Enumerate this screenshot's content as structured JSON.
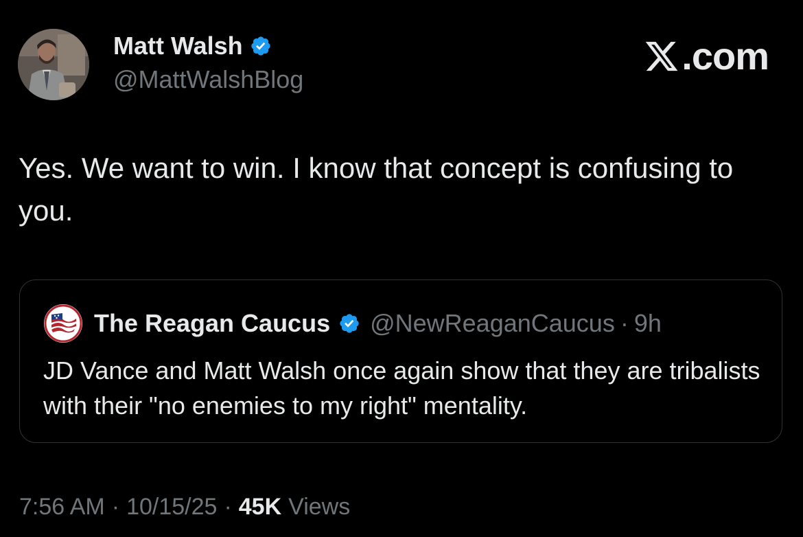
{
  "author": {
    "name": "Matt Walsh",
    "handle": "@MattWalshBlog",
    "verified_icon": "verified-badge-icon"
  },
  "brand": {
    "label": ".com",
    "icon": "x-logo-icon"
  },
  "tweet": {
    "text": "Yes. We want to win. I know that concept is confusing to you."
  },
  "quote": {
    "name": "The Reagan Caucus",
    "handle": "@NewReaganCaucus",
    "separator": "·",
    "time": "9h",
    "text": "JD Vance and Matt Walsh once again show that they are tribalists with their \"no enemies to my right\" mentality."
  },
  "meta": {
    "time": "7:56 AM",
    "separator": "·",
    "date": "10/15/25",
    "views_count": "45K",
    "views_label": "Views"
  },
  "colors": {
    "background": "#000000",
    "text_primary": "#e7e9ea",
    "text_secondary": "#71767b",
    "verified_blue": "#1d9bf0",
    "card_border": "#2f3336"
  }
}
